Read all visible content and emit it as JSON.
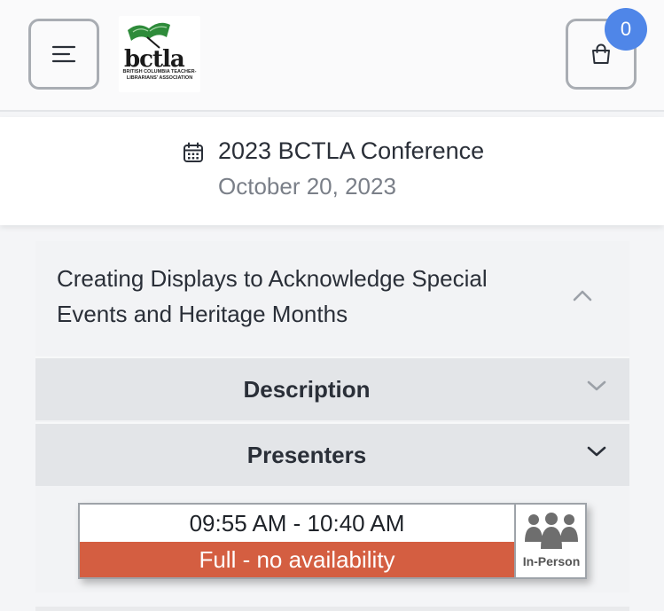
{
  "header": {
    "menu_icon": "hamburger-menu-icon",
    "logo": {
      "wordmark": "bctla",
      "subtitle": "BRITISH COLUMBIA TEACHER-LIBRARIANS' ASSOCIATION"
    },
    "cart": {
      "icon": "shopping-bag-icon",
      "count": "0"
    }
  },
  "event": {
    "icon": "calendar-icon",
    "title": "2023 BCTLA Conference",
    "date": "October 20, 2023"
  },
  "session": {
    "title": "Creating Displays to Acknowledge Special Events and Heritage Months",
    "sections": [
      {
        "label": "Description"
      },
      {
        "label": "Presenters"
      }
    ],
    "slot": {
      "time": "09:55 AM - 10:40 AM",
      "status": "Full - no availability",
      "mode": "In-Person",
      "mode_icon": "people-group-icon"
    }
  },
  "colors": {
    "badge": "#4f86e8",
    "status_full": "#d45e41",
    "logo_green": "#2e8b3a"
  }
}
